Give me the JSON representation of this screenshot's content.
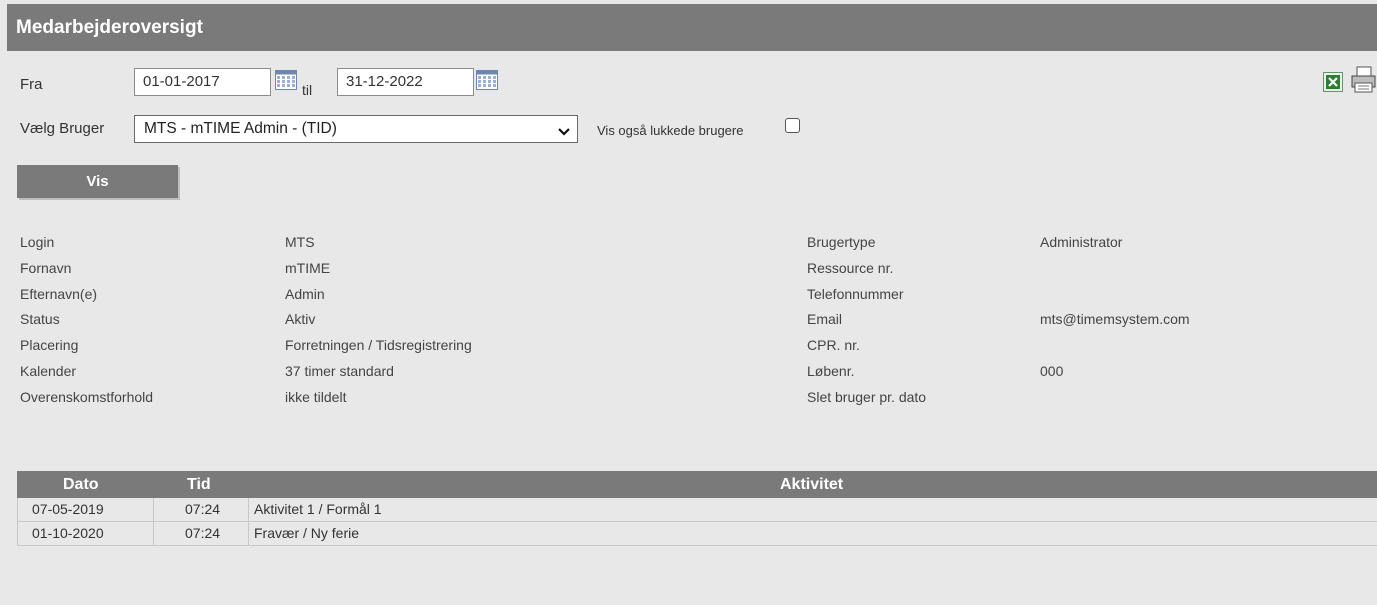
{
  "header": {
    "title": "Medarbejderoversigt"
  },
  "filter": {
    "from_label": "Fra",
    "from_value": "01-01-2017",
    "to_label": "til",
    "to_value": "31-12-2022",
    "user_label": "Vælg Bruger",
    "user_value": "MTS - mTIME Admin - (TID)",
    "closed_label": "Vis også lukkede brugere",
    "closed_checked": false,
    "show_button": "Vis"
  },
  "icons": {
    "excel": "excel-export-icon",
    "print": "print-icon",
    "calendar": "calendar-icon"
  },
  "info_left": [
    {
      "label": "Login",
      "value": "MTS"
    },
    {
      "label": "Fornavn",
      "value": "mTIME"
    },
    {
      "label": "Efternavn(e)",
      "value": "Admin"
    },
    {
      "label": "Status",
      "value": "Aktiv"
    },
    {
      "label": "Placering",
      "value": "Forretningen / Tidsregistrering"
    },
    {
      "label": "Kalender",
      "value": "37 timer standard"
    },
    {
      "label": "Overenskomstforhold",
      "value": "ikke tildelt"
    }
  ],
  "info_right": [
    {
      "label": "Brugertype",
      "value": "Administrator"
    },
    {
      "label": "Ressource nr.",
      "value": ""
    },
    {
      "label": "Telefonnummer",
      "value": ""
    },
    {
      "label": "Email",
      "value": "mts@timemsystem.com"
    },
    {
      "label": "CPR. nr.",
      "value": ""
    },
    {
      "label": "Løbenr.",
      "value": "000"
    },
    {
      "label": "Slet bruger pr. dato",
      "value": ""
    }
  ],
  "table": {
    "headers": {
      "date": "Dato",
      "time": "Tid",
      "activity": "Aktivitet"
    },
    "rows": [
      {
        "date": "07-05-2019",
        "time": "07:24",
        "activity": "Aktivitet 1 / Formål 1"
      },
      {
        "date": "01-10-2020",
        "time": "07:24",
        "activity": "Fravær / Ny ferie"
      }
    ]
  },
  "colors": {
    "header_bg": "#7a7a7a",
    "page_bg": "#e8e8e8",
    "excel_green": "#2e7d32"
  }
}
